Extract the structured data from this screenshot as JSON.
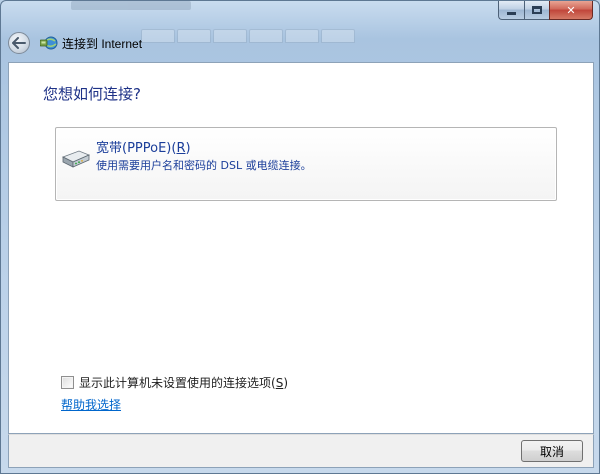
{
  "window": {
    "title": "连接到 Internet",
    "caption": {
      "minimize_icon": "minimize-icon",
      "maximize_icon": "maximize-icon",
      "close_icon": "close-icon",
      "close_glyph": "✕"
    }
  },
  "nav": {
    "back_icon": "back-arrow-icon",
    "app_icon": "network-connect-icon"
  },
  "main": {
    "heading": "您想如何连接?",
    "options": [
      {
        "icon": "broadband-modem-icon",
        "title": "宽带(PPPoE)(",
        "accelerator": "R",
        "title_suffix": ")",
        "description": "使用需要用户名和密码的 DSL 或电缆连接。"
      }
    ],
    "show_options_checkbox": {
      "checked": false,
      "label": "显示此计算机未设置使用的连接选项(",
      "accelerator": "S",
      "label_suffix": ")"
    },
    "help_link": "帮助我选择"
  },
  "footer": {
    "cancel_label": "取消"
  },
  "colors": {
    "heading": "#1e3287",
    "option_text": "#1b3e9a",
    "link": "#0066cc",
    "glass": "#b8cfe6"
  }
}
